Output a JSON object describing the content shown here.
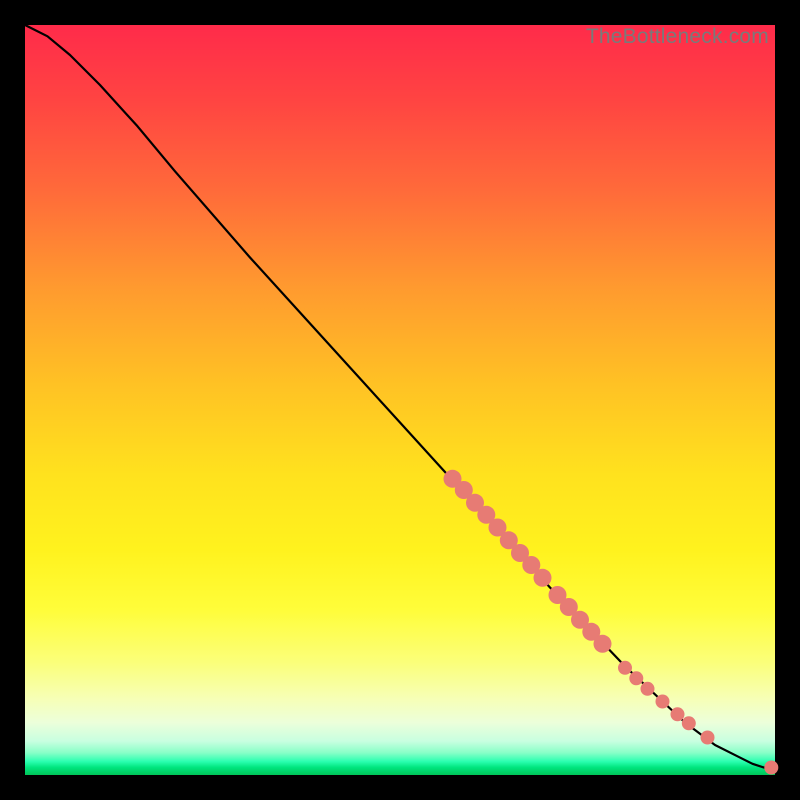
{
  "watermark": "TheBottleneck.com",
  "dot_color": "#e77b74",
  "curve_color": "#000000",
  "chart_data": {
    "type": "line",
    "title": "",
    "xlabel": "",
    "ylabel": "",
    "xlim": [
      0,
      100
    ],
    "ylim": [
      0,
      100
    ],
    "grid": false,
    "legend": false,
    "series": [
      {
        "name": "curve",
        "style": "line",
        "x": [
          0,
          3,
          6,
          10,
          15,
          20,
          30,
          40,
          50,
          60,
          70,
          80,
          88,
          92,
          95,
          97,
          98.5,
          100
        ],
        "y": [
          100,
          98.5,
          96,
          92,
          86.5,
          80.5,
          69,
          58,
          47,
          36,
          25,
          14.5,
          7,
          4,
          2.5,
          1.5,
          1,
          1
        ]
      },
      {
        "name": "markers",
        "style": "scatter",
        "r_large": 9,
        "r_small": 7,
        "points": [
          {
            "x": 57,
            "y": 39.5,
            "r": 9
          },
          {
            "x": 58.5,
            "y": 38,
            "r": 9
          },
          {
            "x": 60,
            "y": 36.3,
            "r": 9
          },
          {
            "x": 61.5,
            "y": 34.7,
            "r": 9
          },
          {
            "x": 63,
            "y": 33,
            "r": 9
          },
          {
            "x": 64.5,
            "y": 31.3,
            "r": 9
          },
          {
            "x": 66,
            "y": 29.6,
            "r": 9
          },
          {
            "x": 67.5,
            "y": 28,
            "r": 9
          },
          {
            "x": 69,
            "y": 26.3,
            "r": 9
          },
          {
            "x": 71,
            "y": 24,
            "r": 9
          },
          {
            "x": 72.5,
            "y": 22.4,
            "r": 9
          },
          {
            "x": 74,
            "y": 20.7,
            "r": 9
          },
          {
            "x": 75.5,
            "y": 19.1,
            "r": 9
          },
          {
            "x": 77,
            "y": 17.5,
            "r": 9
          },
          {
            "x": 80,
            "y": 14.3,
            "r": 7
          },
          {
            "x": 81.5,
            "y": 12.9,
            "r": 7
          },
          {
            "x": 83,
            "y": 11.5,
            "r": 7
          },
          {
            "x": 85,
            "y": 9.8,
            "r": 7
          },
          {
            "x": 87,
            "y": 8.1,
            "r": 7
          },
          {
            "x": 88.5,
            "y": 6.9,
            "r": 7
          },
          {
            "x": 91,
            "y": 5,
            "r": 7
          },
          {
            "x": 99.5,
            "y": 1,
            "r": 7
          }
        ]
      }
    ]
  }
}
